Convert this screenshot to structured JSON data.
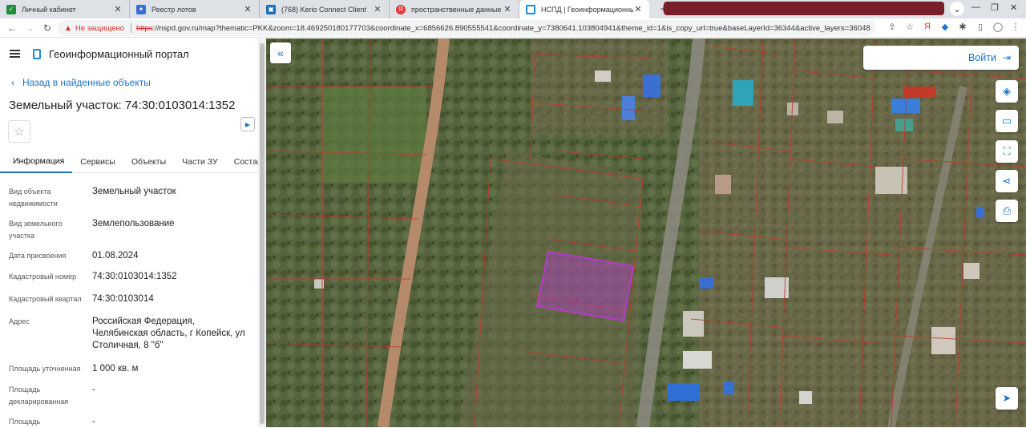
{
  "browser": {
    "tabs": [
      {
        "title": "Личный кабинет",
        "icon": "shield-icon",
        "color": "#1e8e3e"
      },
      {
        "title": "Реестр лотов",
        "icon": "emblem-icon",
        "color": "#3a6fd8"
      },
      {
        "title": "(768) Kerio Connect Client",
        "icon": "kerio-icon",
        "color": "#1c6db5"
      },
      {
        "title": "пространственные данные росреестр",
        "icon": "yandex-icon",
        "color": "#e53935"
      },
      {
        "title": "НСПД | Геоинформационный портал",
        "icon": "nspd-icon",
        "color": "#1d8cd8"
      }
    ],
    "security_label": "Не защищено",
    "url_scheme": "https",
    "url_rest": "://nspd.gov.ru/map?thematic=PKK&zoom=18.469250180177703&coordinate_x=6856626.890555541&coordinate_y=7380641.103804941&theme_id=1&is_copy_url=true&baseLayerId=36344&active_layers=36048"
  },
  "header": {
    "portal_title": "Геоинформационный портал",
    "back_label": "Назад в найденные объекты",
    "object_title": "Земельный участок: 74:30:0103014:1352"
  },
  "panel_tabs": [
    "Информация",
    "Сервисы",
    "Объекты",
    "Части ЗУ",
    "Состав"
  ],
  "attributes": [
    {
      "key": "Вид объекта недвижимости",
      "value": "Земельный участок"
    },
    {
      "key": "Вид земельного участка",
      "value": "Землепользование"
    },
    {
      "key": "Дата присвоения",
      "value": "01.08.2024"
    },
    {
      "key": "Кадастровый номер",
      "value": "74:30:0103014:1352"
    },
    {
      "key": "Кадастровый квартал",
      "value": "74:30:0103014"
    },
    {
      "key": "Адрес",
      "value": "Российская Федерация, Челябинская область, г Копейск, ул Столичная, 8 \"б\""
    },
    {
      "key": "Площадь уточненная",
      "value": "1 000 кв. м"
    },
    {
      "key": "Площадь декларированная",
      "value": "-"
    },
    {
      "key": "Площадь",
      "value": "-"
    }
  ],
  "map": {
    "login_label": "Войти",
    "highlight_color": "#b43cc8",
    "boundary_color": "#c0392b"
  }
}
